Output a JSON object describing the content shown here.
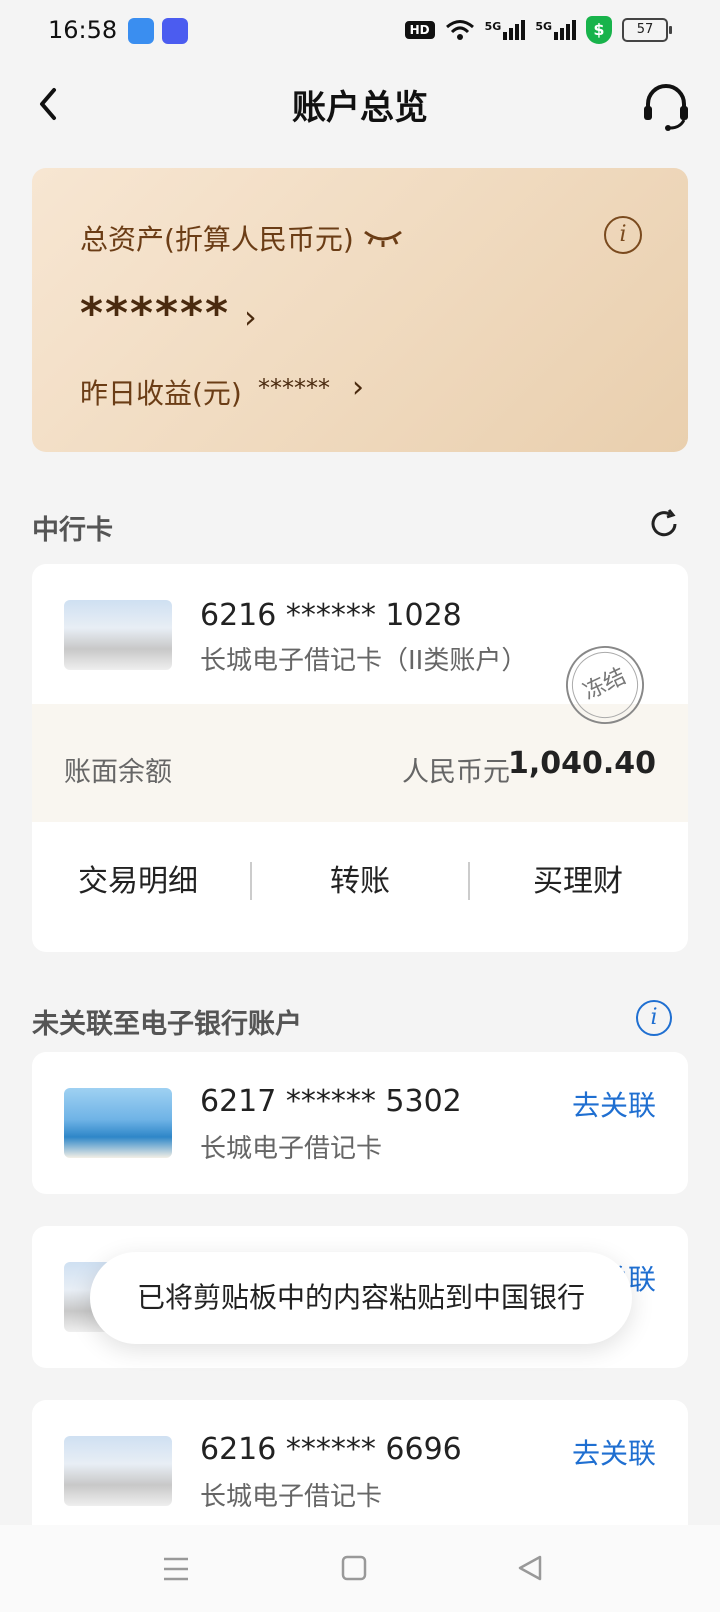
{
  "status_bar": {
    "time": "16:58",
    "hd": "HD",
    "net1": "5G",
    "net2": "5G",
    "battery": "57"
  },
  "header": {
    "title": "账户总览"
  },
  "assets": {
    "total_label": "总资产(折算人民币元)",
    "total_value": "******",
    "yesterday_label": "昨日收益(元)",
    "yesterday_value": "******",
    "info_glyph": "i"
  },
  "boc_section": {
    "title": "中行卡",
    "card": {
      "number": "6216 ****** 1028",
      "type": "长城电子借记卡（II类账户）",
      "stamp": "冻结",
      "balance_label": "账面余额",
      "currency": "人民币元",
      "balance": "1,040.40",
      "actions": [
        "交易明细",
        "转账",
        "买理财"
      ]
    }
  },
  "unlinked_section": {
    "title": "未关联至电子银行账户",
    "info_glyph": "i",
    "cards": [
      {
        "number": "6217 ****** 5302",
        "type": "长城电子借记卡",
        "action": "去关联"
      },
      {
        "action": "去关联"
      },
      {
        "number": "6216 ****** 6696",
        "type": "长城电子借记卡",
        "action": "去关联"
      }
    ]
  },
  "toast": {
    "text": "已将剪贴板中的内容粘贴到中国银行"
  }
}
